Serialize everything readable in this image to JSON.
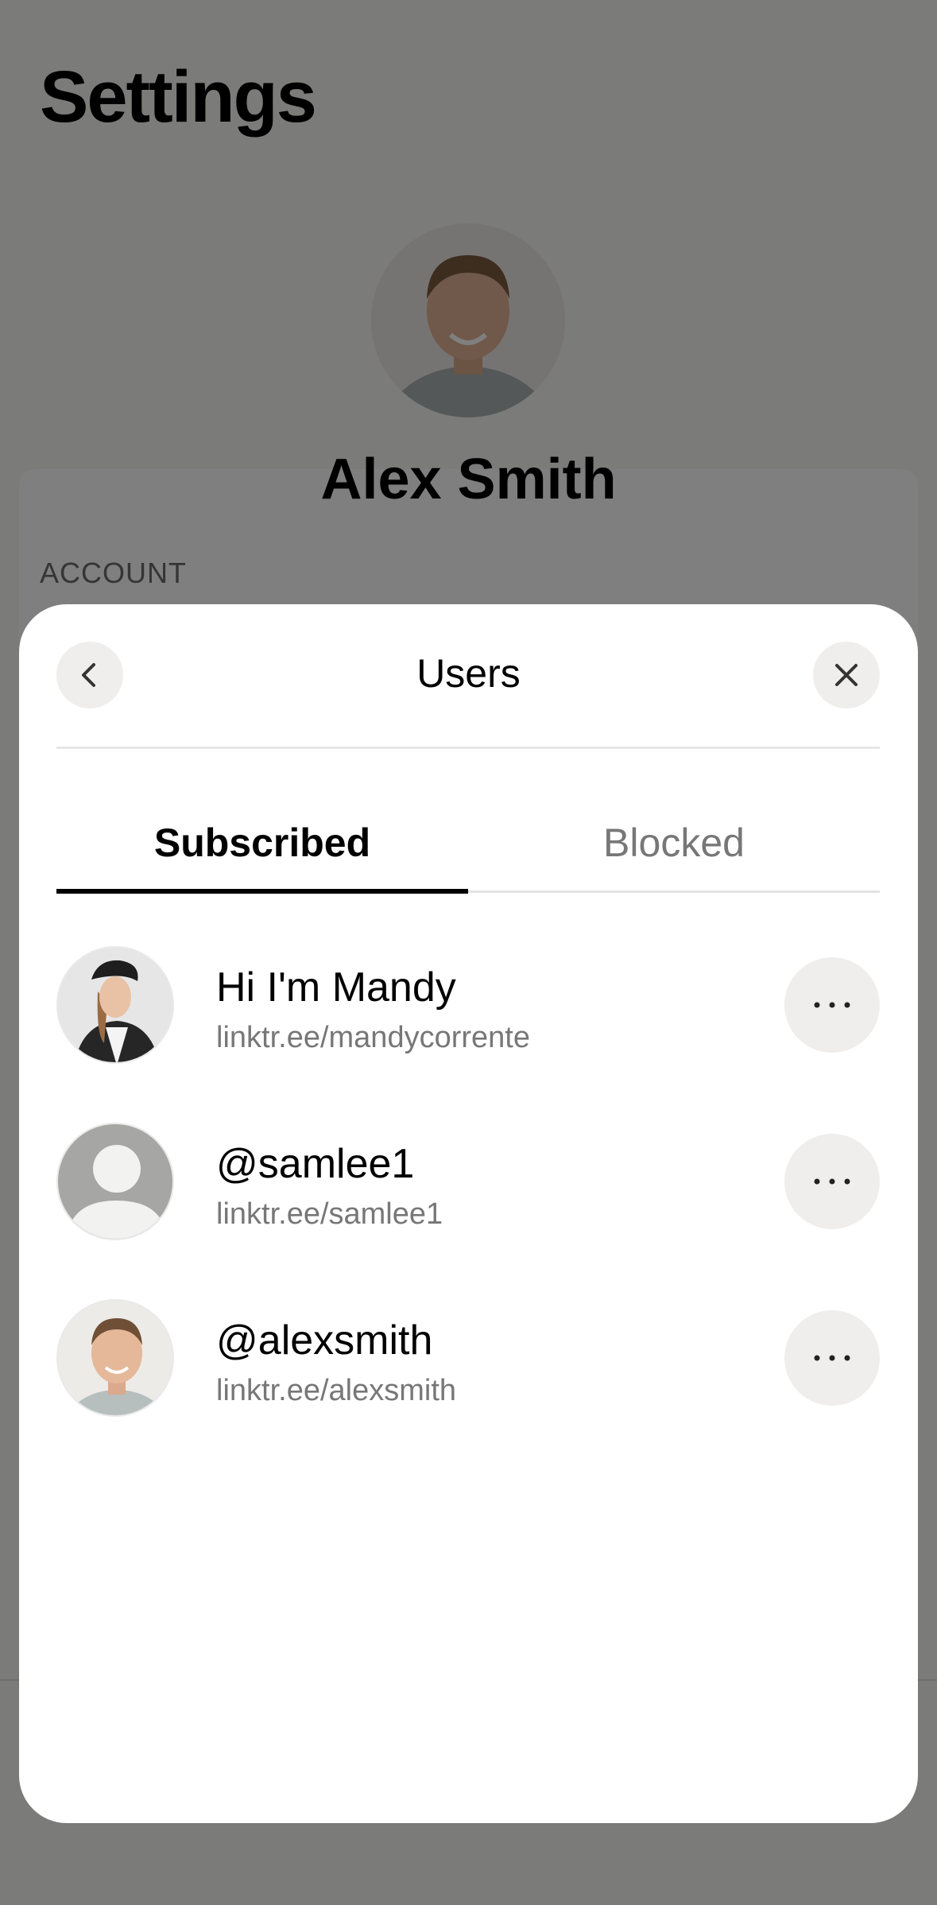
{
  "background": {
    "page_title": "Settings",
    "profile_name": "Alex Smith",
    "section_label": "ACCOUNT"
  },
  "sheet": {
    "title": "Users",
    "back_icon": "chevron-left-icon",
    "close_icon": "close-icon",
    "tabs": [
      {
        "label": "Subscribed",
        "active": true
      },
      {
        "label": "Blocked",
        "active": false
      }
    ],
    "users": [
      {
        "name": "Hi I'm Mandy",
        "link": "linktr.ee/mandycorrente",
        "avatar": "photo-mandy"
      },
      {
        "name": "@samlee1",
        "link": "linktr.ee/samlee1",
        "avatar": "placeholder-person-icon"
      },
      {
        "name": "@alexsmith",
        "link": "linktr.ee/alexsmith",
        "avatar": "photo-alex"
      }
    ]
  },
  "colors": {
    "active_tab": "#000000",
    "inactive_tab": "#777777",
    "button_bg": "#efeeec"
  }
}
